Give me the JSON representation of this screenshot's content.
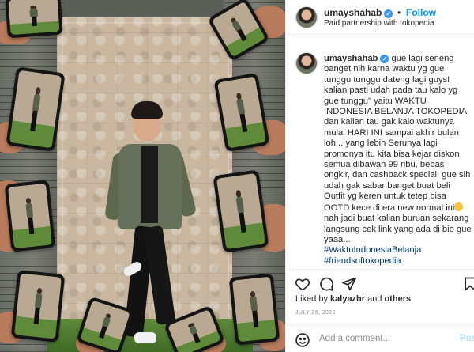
{
  "header": {
    "username": "umayshahab",
    "dot": "•",
    "follow_label": "Follow",
    "paid_partnership": "Paid partnership with tokopedia"
  },
  "caption": {
    "username": "umayshahab",
    "part1": "gue lagi seneng banget nih karna waktu yg gue tunggu tunggu dateng lagi guys! kalian pasti udah pada tau kalo yg gue tunggu\" yaitu WAKTU INDONESIA BELANJA TOKOPEDIA dan kalian tau gak kalo waktunya mulai HARI INI sampai akhir bulan loh... yang lebih Serunya lagi promonya itu kita bisa kejar diskon semua dibawah 99 ribu, bebas ongkir, dan cashback special! gue sih udah gak sabar banget buat beli Outfit yg keren untuk tetep bisa OOTD kece di era new normal ini",
    "part2": " nah jadi buat kalian buruan sekarang langsung cek link yang ada di bio gue yaaa...",
    "hashtag1": "#WaktuIndonesiaBelanja",
    "hashtag2": "#friendsoftokopedia"
  },
  "likes": {
    "prefix": "Liked by ",
    "user": "kalyazhr",
    "and": " and ",
    "others": "others"
  },
  "date": "JULY 26, 2020",
  "comment": {
    "placeholder": "Add a comment...",
    "post_label": "Post"
  },
  "icons": {
    "verified": "verified-badge-icon",
    "heart": "heart-icon",
    "comment": "comment-icon",
    "share": "share-icon",
    "smile": "emoji-smile-icon"
  },
  "colors": {
    "follow": "#0095f6",
    "verified": "#3897f0",
    "hashtag": "#00376b",
    "muted": "#8e8e8e",
    "post_disabled": "#b2dffc"
  }
}
